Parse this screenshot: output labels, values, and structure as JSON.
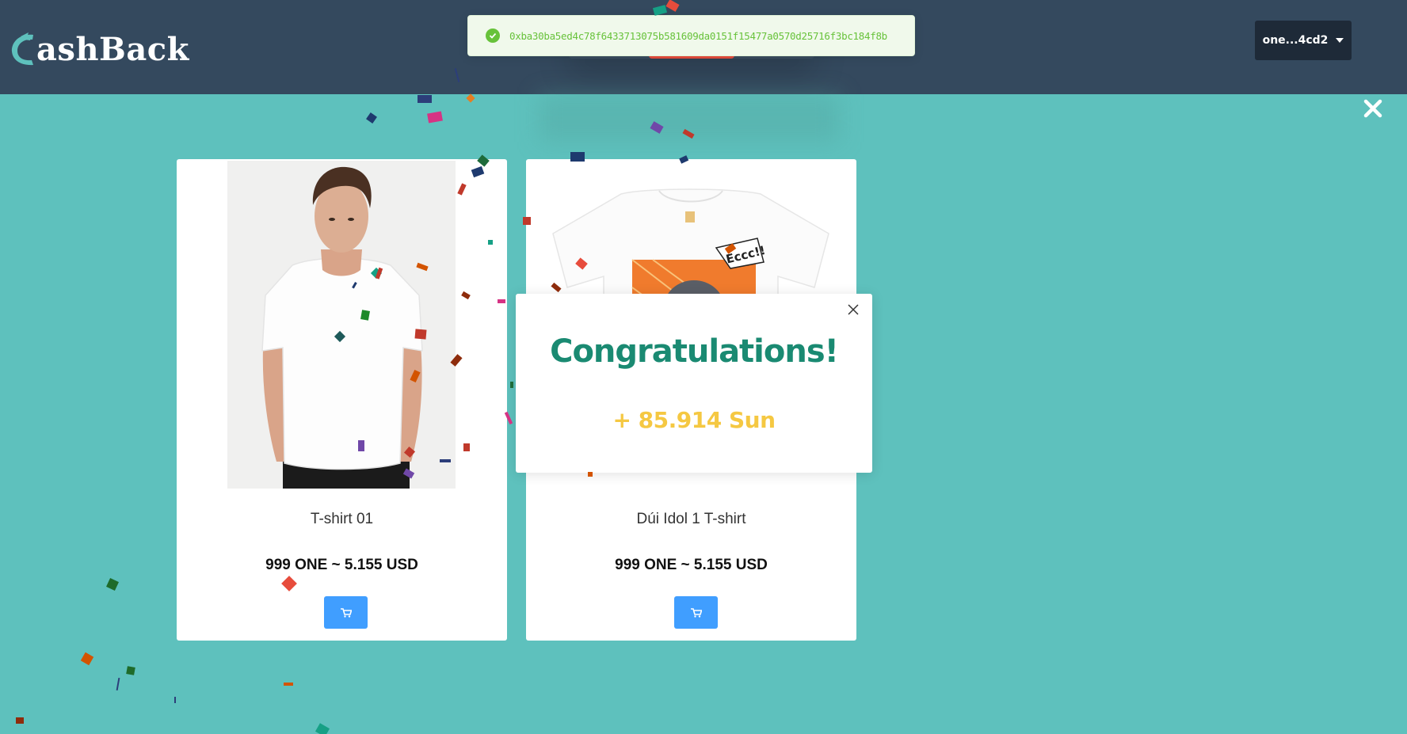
{
  "header": {
    "logo_text": "ashBack",
    "wallet_label": "one...4cd2"
  },
  "toast": {
    "message": "0xba30ba5ed4c78f6433713075b581609da0151f15477a0570d25716f3bc184f8b"
  },
  "products": [
    {
      "title": "T-shirt 01",
      "price": "999 ONE ~ 5.155 USD"
    },
    {
      "title": "Dúi Idol 1 T-shirt",
      "price": "999 ONE ~ 5.155 USD"
    }
  ],
  "modal": {
    "title": "Congratulations!",
    "reward": "+ 85.914 Sun"
  },
  "colors": {
    "header_bg": "#34495e",
    "page_bg": "#5ec1bd",
    "success": "#67c23a",
    "accent_blue": "#409eff",
    "title_green": "#1a8a72",
    "reward_yellow": "#f5c842"
  },
  "icons": {
    "logo": "cashback-c-logo-icon",
    "toast": "check-circle-icon",
    "close_page": "close-x-icon",
    "close_modal": "close-icon",
    "cart": "cart-icon",
    "dropdown": "caret-down-icon"
  }
}
